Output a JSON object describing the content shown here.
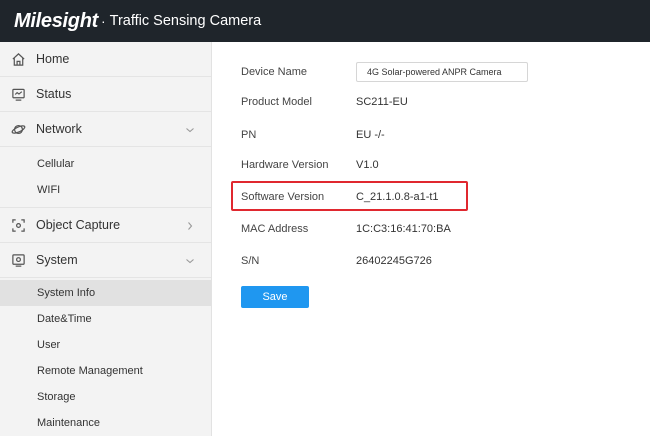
{
  "header": {
    "brand": "Milesight",
    "separator": "·",
    "product": "Traffic Sensing Camera"
  },
  "sidebar": {
    "home": {
      "label": "Home",
      "icon": "home-icon"
    },
    "status": {
      "label": "Status",
      "icon": "monitor-icon"
    },
    "network": {
      "label": "Network",
      "icon": "planet-icon",
      "children": [
        "Cellular",
        "WIFI"
      ]
    },
    "object_capture": {
      "label": "Object Capture",
      "icon": "camera-icon"
    },
    "system": {
      "label": "System",
      "icon": "system-icon",
      "children": [
        "System Info",
        "Date&Time",
        "User",
        "Remote Management",
        "Storage",
        "Maintenance"
      ]
    }
  },
  "form": {
    "device_name": {
      "label": "Device Name",
      "value": "4G Solar-powered ANPR Camera"
    },
    "product_model": {
      "label": "Product Model",
      "value": "SC211-EU"
    },
    "pn": {
      "label": "PN",
      "value": "EU -/-"
    },
    "hardware_version": {
      "label": "Hardware Version",
      "value": "V1.0"
    },
    "software_version": {
      "label": "Software Version",
      "value": "C_21.1.0.8-a1-t1"
    },
    "mac_address": {
      "label": "MAC Address",
      "value": "1C:C3:16:41:70:BA"
    },
    "sn": {
      "label": "S/N",
      "value": "26402245G726"
    }
  },
  "save_label": "Save",
  "colors": {
    "header_bg": "#1f252b",
    "accent": "#1f97f0",
    "highlight": "#e0282f",
    "sidebar_bg": "#f3f3f3",
    "active_item_bg": "#e1e1e1"
  }
}
